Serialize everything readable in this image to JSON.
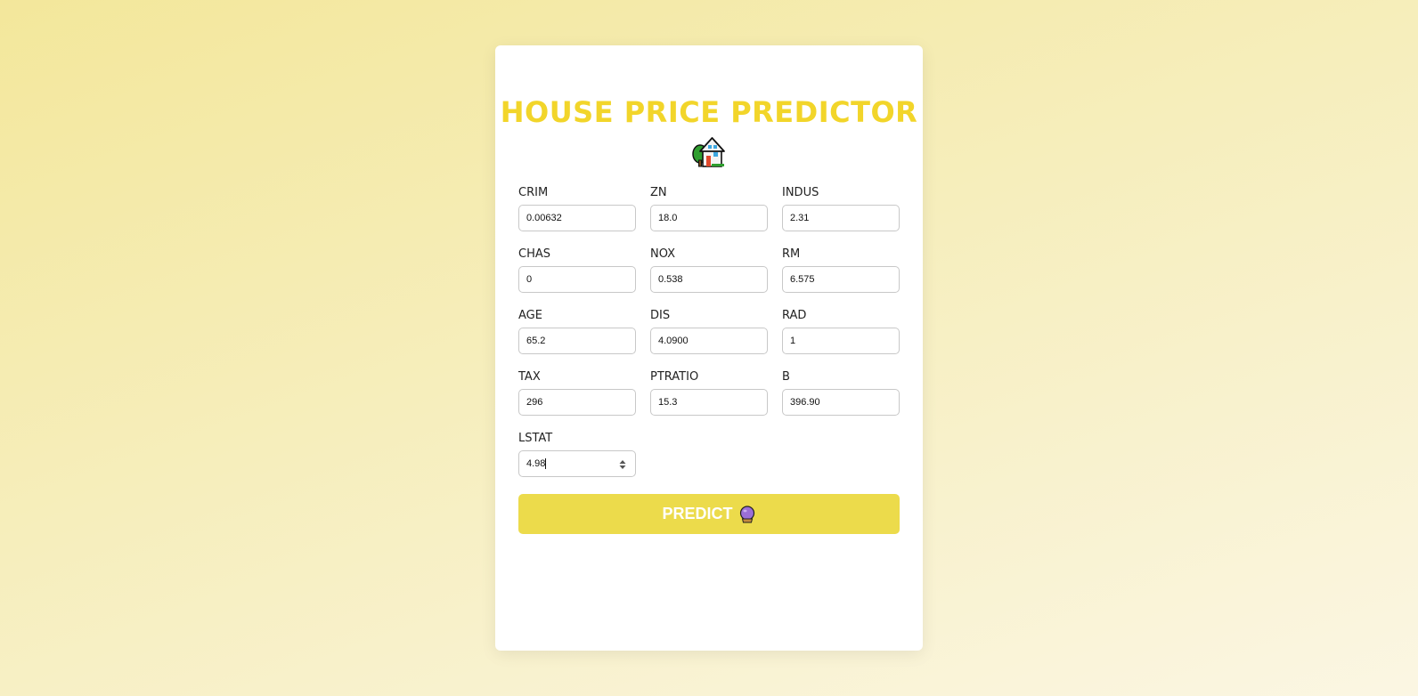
{
  "title": "HOUSE PRICE PREDICTOR",
  "icons": {
    "title_icon": "house-with-garden-icon",
    "button_icon": "crystal-ball-icon"
  },
  "colors": {
    "accent": "#f2d52a",
    "button": "#ecdb4b",
    "background_start": "#f3e79b",
    "background_end": "#fbf6e3"
  },
  "fields": [
    {
      "label": "CRIM",
      "value": "0.00632"
    },
    {
      "label": "ZN",
      "value": "18.0"
    },
    {
      "label": "INDUS",
      "value": "2.31"
    },
    {
      "label": "CHAS",
      "value": "0"
    },
    {
      "label": "NOX",
      "value": "0.538"
    },
    {
      "label": "RM",
      "value": "6.575"
    },
    {
      "label": "AGE",
      "value": "65.2"
    },
    {
      "label": "DIS",
      "value": "4.0900"
    },
    {
      "label": "RAD",
      "value": "1"
    },
    {
      "label": "TAX",
      "value": "296"
    },
    {
      "label": "PTRATIO",
      "value": "15.3"
    },
    {
      "label": "B",
      "value": "396.90"
    },
    {
      "label": "LSTAT",
      "value": "4.98"
    }
  ],
  "button": {
    "label": "PREDICT"
  }
}
